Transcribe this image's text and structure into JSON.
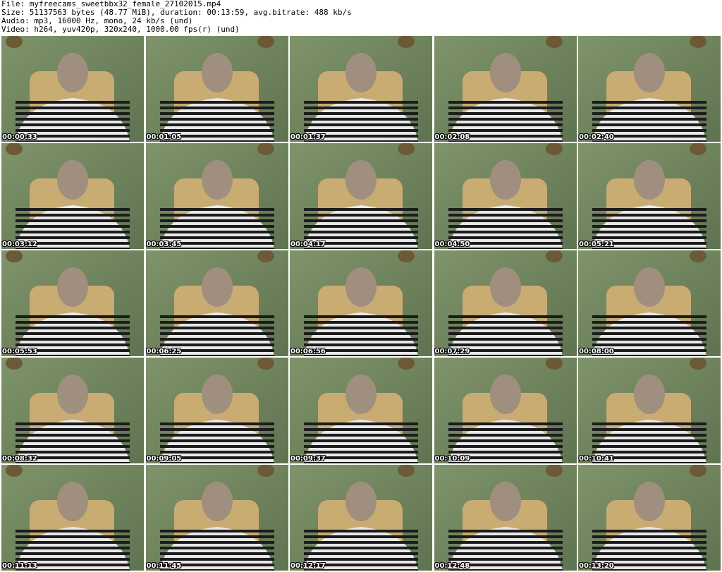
{
  "header": {
    "file_line": "File: myfreecams_sweetbbx32_female_27102015.mp4",
    "size_line": "Size: 51137563 bytes (48.77 MiB), duration: 00:13:59, avg.bitrate: 488 kb/s",
    "audio_line": "Audio: mp3, 16000 Hz, mono, 24 kb/s (und)",
    "video_line": "Video: h264, yuv420p, 320x240, 1000.00 fps(r) (und)"
  },
  "colors": {
    "wall": "#7f946a",
    "wall_dark": "#5e7350",
    "chair": "#c9ac72",
    "ornament": "#6b5a35",
    "stripe_dark": "#1c1c1c",
    "stripe_light": "#e8e8e8",
    "placeholder": "#a08f7e"
  },
  "thumbnails": [
    {
      "timestamp": "00:00:33"
    },
    {
      "timestamp": "00:01:05"
    },
    {
      "timestamp": "00:01:37"
    },
    {
      "timestamp": "00:02:08"
    },
    {
      "timestamp": "00:02:40"
    },
    {
      "timestamp": "00:03:12"
    },
    {
      "timestamp": "00:03:45"
    },
    {
      "timestamp": "00:04:17"
    },
    {
      "timestamp": "00:04:50"
    },
    {
      "timestamp": "00:05:21"
    },
    {
      "timestamp": "00:05:53"
    },
    {
      "timestamp": "00:06:25"
    },
    {
      "timestamp": "00:06:56"
    },
    {
      "timestamp": "00:07:29"
    },
    {
      "timestamp": "00:08:00"
    },
    {
      "timestamp": "00:08:32"
    },
    {
      "timestamp": "00:09:05"
    },
    {
      "timestamp": "00:09:37"
    },
    {
      "timestamp": "00:10:09"
    },
    {
      "timestamp": "00:10:41"
    },
    {
      "timestamp": "00:11:13"
    },
    {
      "timestamp": "00:11:45"
    },
    {
      "timestamp": "00:12:17"
    },
    {
      "timestamp": "00:12:48"
    },
    {
      "timestamp": "00:13:20"
    }
  ]
}
